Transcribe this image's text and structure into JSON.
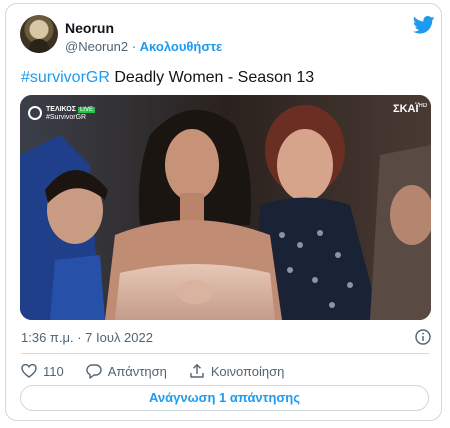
{
  "author": {
    "display_name": "Neorun",
    "handle": "@Neorun2",
    "separator": "·",
    "follow_label": "Ακολουθήστε"
  },
  "tweet": {
    "hashtag": "#survivorGR",
    "text": " Deadly Women - Season 13"
  },
  "media": {
    "overlay_live_title": "ΤΕΛΙΚΟΣ",
    "overlay_live_badge": "LIVE",
    "overlay_tag": "#SurvivorGR",
    "channel_logo": "ΣΚΑΪ",
    "channel_suffix": "HD"
  },
  "meta": {
    "timestamp": "1:36 π.μ. · 7 Ιουλ 2022"
  },
  "actions": {
    "like_count": "110",
    "reply_label": "Απάντηση",
    "share_label": "Κοινοποίηση"
  },
  "footer": {
    "read_replies_label": "Ανάγνωση 1 απάντησης"
  },
  "colors": {
    "accent": "#1d9bf0",
    "secondary_text": "#536471",
    "border": "#cfd9de"
  },
  "icons": [
    "twitter-logo-icon",
    "info-icon",
    "heart-icon",
    "reply-icon",
    "share-icon"
  ]
}
